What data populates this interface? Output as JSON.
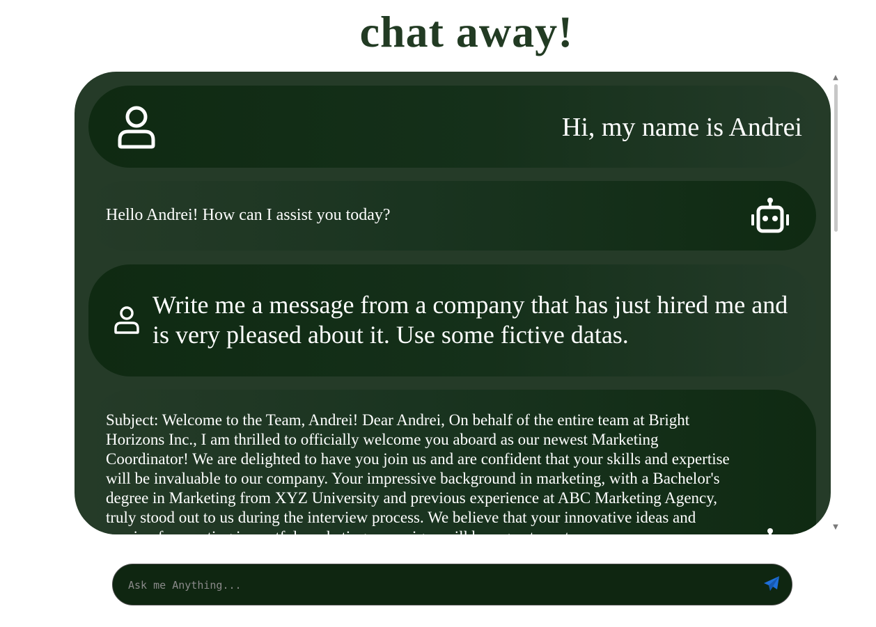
{
  "page": {
    "title": "chat away!"
  },
  "colors": {
    "title": "#223b23",
    "chat_background": "#253b28",
    "bubble_dark": "#0f2a12",
    "composer_background": "#0f2611",
    "send_icon": "#1e6fd9"
  },
  "chat": {
    "messages": [
      {
        "role": "user",
        "icon": "user-icon",
        "text": "Hi, my name is Andrei"
      },
      {
        "role": "bot",
        "icon": "robot-icon",
        "text": "Hello Andrei! How can I assist you today?"
      },
      {
        "role": "user",
        "icon": "user-icon",
        "text": "Write me a message from a company that has just hired me and is very pleased about it. Use some fictive datas."
      },
      {
        "role": "bot",
        "icon": "robot-icon",
        "text": "Subject: Welcome to the Team, Andrei! Dear Andrei, On behalf of the entire team at Bright Horizons Inc., I am thrilled to officially welcome you aboard as our newest Marketing Coordinator! We are delighted to have you join us and are confident that your skills and expertise will be invaluable to our company. Your impressive background in marketing, with a Bachelor's degree in Marketing from XYZ University and previous experience at ABC Marketing Agency, truly stood out to us during the interview process. We believe that your innovative ideas and passion for creating impactful marketing campaigns will be a great asset."
      }
    ]
  },
  "composer": {
    "placeholder": "Ask me Anything...",
    "value": "",
    "send_icon": "send-icon"
  }
}
